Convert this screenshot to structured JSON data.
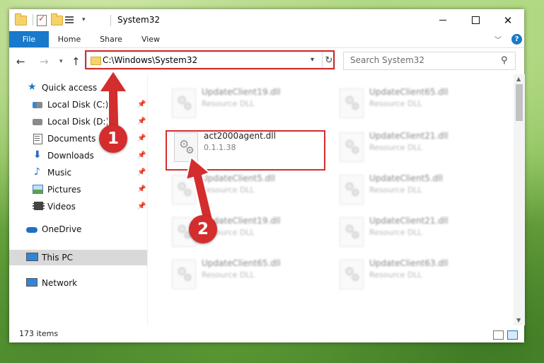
{
  "window": {
    "title": "System32",
    "controls": {
      "minimize": "minimize",
      "maximize": "maximize",
      "close": "✕"
    }
  },
  "ribbon": {
    "tabs": [
      "File",
      "Home",
      "Share",
      "View"
    ],
    "help": "?"
  },
  "address_bar": {
    "path": "C:\\Windows\\System32",
    "refresh_icon": "↻"
  },
  "search": {
    "placeholder": "Search System32"
  },
  "sidebar": {
    "items": [
      {
        "label": "Quick access",
        "icon": "star-icon",
        "pinned": false
      },
      {
        "label": "Local Disk (C:)",
        "icon": "drive-icon",
        "pinned": true
      },
      {
        "label": "Local Disk (D:)",
        "icon": "drive-icon",
        "pinned": true
      },
      {
        "label": "Documents",
        "icon": "documents-icon",
        "pinned": true
      },
      {
        "label": "Downloads",
        "icon": "downloads-icon",
        "pinned": true
      },
      {
        "label": "Music",
        "icon": "music-icon",
        "pinned": true
      },
      {
        "label": "Pictures",
        "icon": "pictures-icon",
        "pinned": true
      },
      {
        "label": "Videos",
        "icon": "videos-icon",
        "pinned": true
      },
      {
        "label": "OneDrive",
        "icon": "onedrive-icon",
        "pinned": false
      },
      {
        "label": "This PC",
        "icon": "pc-icon",
        "pinned": false,
        "selected": true
      },
      {
        "label": "Network",
        "icon": "network-icon",
        "pinned": false
      }
    ]
  },
  "files": {
    "highlighted": {
      "name": "act2000agent.dll",
      "detail": "0.1.1.38"
    },
    "background": [
      {
        "name": "UpdateClient19.dll",
        "detail": "Resource DLL"
      },
      {
        "name": "UpdateClient65.dll",
        "detail": "Resource DLL"
      },
      {
        "name": "UpdateClient21.dll",
        "detail": "Resource DLL"
      },
      {
        "name": "UpdateClient5.dll",
        "detail": "Resource DLL"
      },
      {
        "name": "UpdateClient5.dll",
        "detail": "Resource DLL"
      },
      {
        "name": "UpdateClient19.dll",
        "detail": "Resource DLL"
      },
      {
        "name": "UpdateClient21.dll",
        "detail": "Resource DLL"
      },
      {
        "name": "UpdateClient65.dll",
        "detail": "Resource DLL"
      },
      {
        "name": "UpdateClient63.dll",
        "detail": "Resource DLL"
      }
    ]
  },
  "status": {
    "item_count": "173 items"
  },
  "annotations": {
    "step1": "1",
    "step2": "2",
    "accent_color": "#d32d2d"
  },
  "colors": {
    "file_tab": "#1979ca",
    "selected_row": "#d9d9d9"
  }
}
